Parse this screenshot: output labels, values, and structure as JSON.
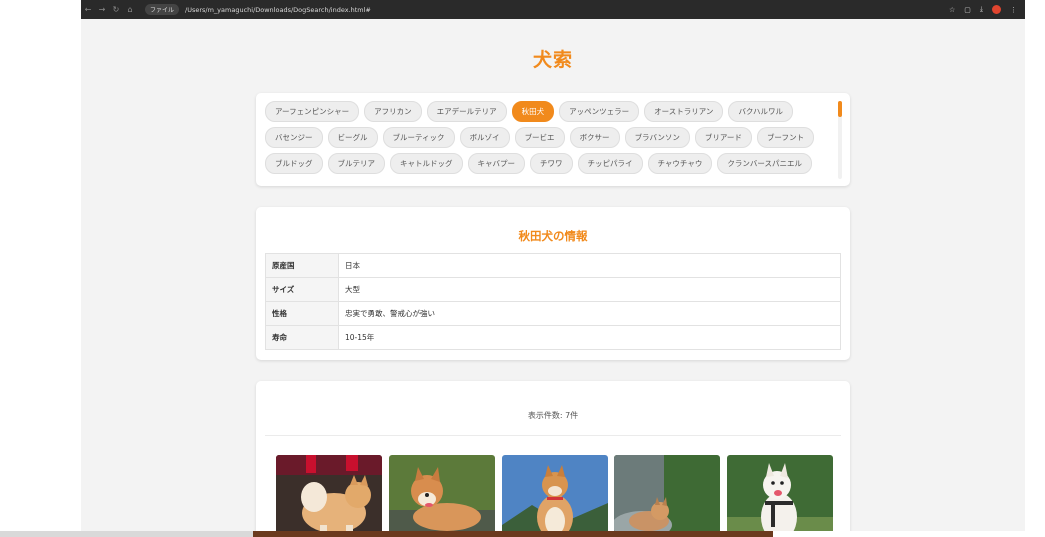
{
  "browser": {
    "file_chip": "ファイル",
    "url": "/Users/m_yamaguchi/Downloads/DogSearch/index.html#"
  },
  "page": {
    "title": "犬索"
  },
  "breeds": {
    "row1": [
      "アーフェンピンシャー",
      "アフリカン",
      "エアデールテリア",
      "秋田犬",
      "アッペンツェラー",
      "オーストラリアン",
      "バクハルワル"
    ],
    "row2": [
      "バセンジー",
      "ビーグル",
      "ブルーティック",
      "ボルゾイ",
      "ブービエ",
      "ボクサー",
      "ブラバンソン",
      "ブリアード",
      "ブーフント"
    ],
    "row3": [
      "ブルドッグ",
      "ブルテリア",
      "キャトルドッグ",
      "キャバプー",
      "チワワ",
      "チッピパライ",
      "チャウチャウ",
      "クランバースパニエル"
    ],
    "selected": "秋田犬"
  },
  "info": {
    "title": "秋田犬の情報",
    "rows": [
      {
        "label": "原産国",
        "value": "日本"
      },
      {
        "label": "サイズ",
        "value": "大型"
      },
      {
        "label": "性格",
        "value": "忠実で勇敢、警戒心が強い"
      },
      {
        "label": "寿命",
        "value": "10-15年"
      }
    ]
  },
  "results": {
    "count_text": "表示件数: 7件"
  },
  "colors": {
    "accent": "#f18a1c",
    "chrome": "#2a2a2a",
    "background": "#f3f3f3"
  }
}
